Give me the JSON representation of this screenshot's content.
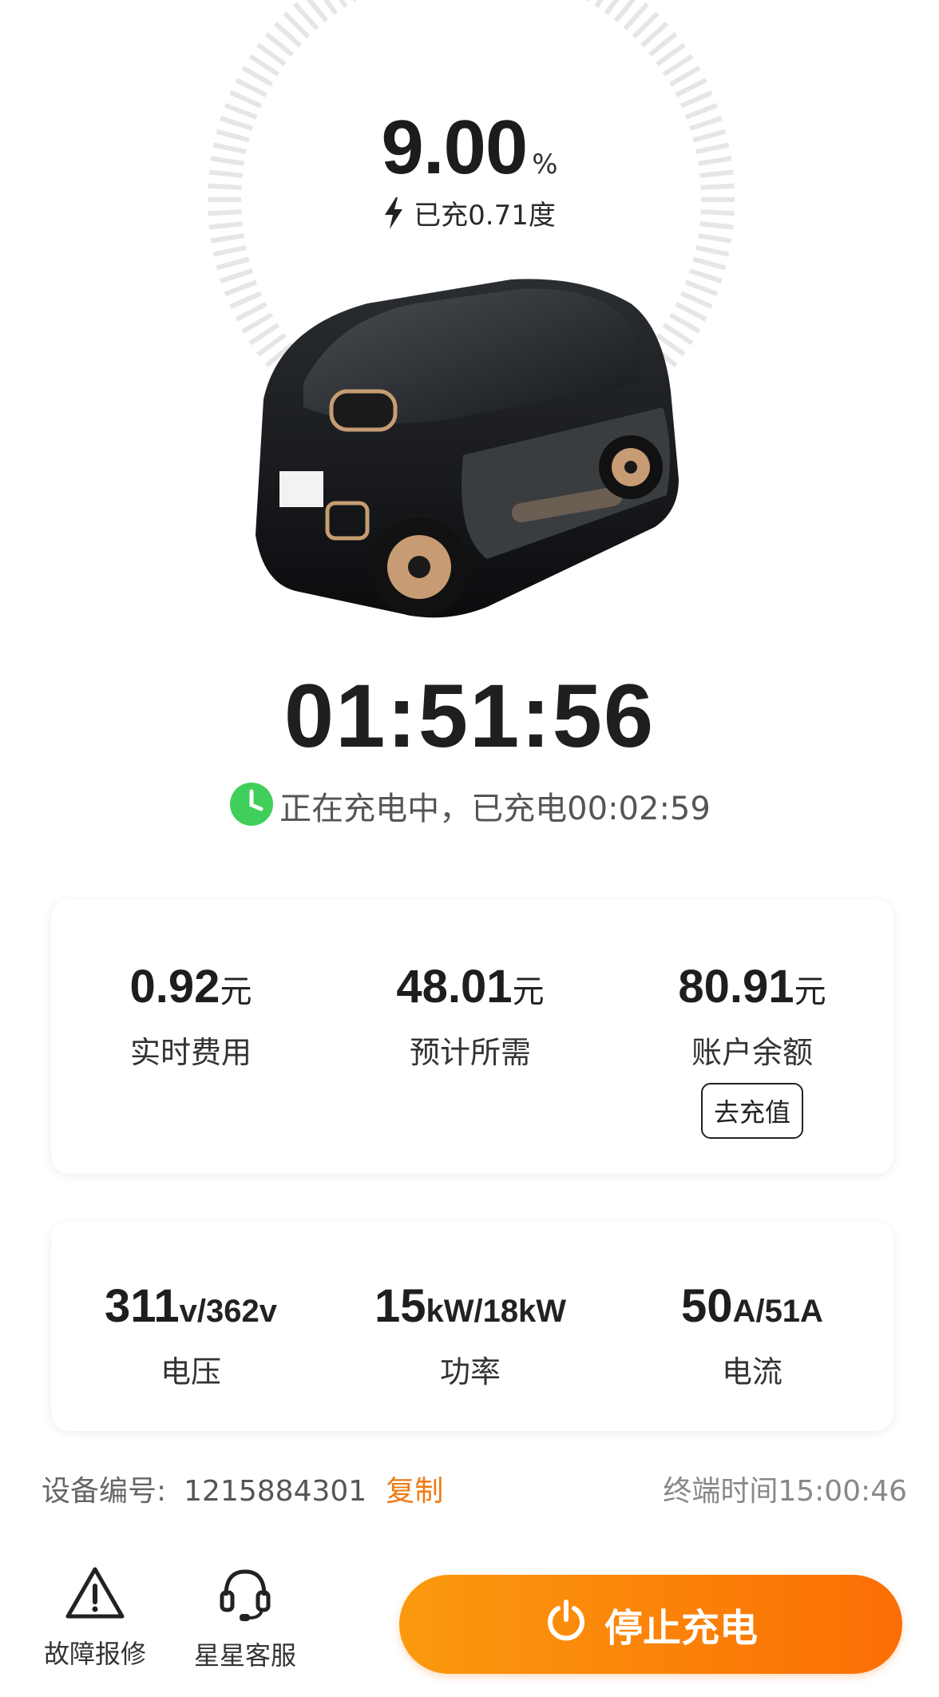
{
  "charge": {
    "percent": "9.00",
    "percent_unit": "%",
    "charged_energy": "已充0.71度",
    "remaining_time": "01:51:56",
    "status_text": "正在充电中，已充电00:02:59"
  },
  "cost_card": {
    "items": [
      {
        "value": "0.92",
        "unit": "元",
        "label": "实时费用"
      },
      {
        "value": "48.01",
        "unit": "元",
        "label": "预计所需"
      },
      {
        "value": "80.91",
        "unit": "元",
        "label": "账户余额"
      }
    ],
    "recharge_label": "去充值"
  },
  "power_card": {
    "items": [
      {
        "value": "311",
        "unit": "v/362v",
        "label": "电压"
      },
      {
        "value": "15",
        "unit": "kW/18kW",
        "label": "功率"
      },
      {
        "value": "50",
        "unit": "A/51A",
        "label": "电流"
      }
    ]
  },
  "device": {
    "label": "设备编号:",
    "number": "1215884301",
    "copy_label": "复制",
    "terminal_time": "终端时间15:00:46"
  },
  "bottom_bar": {
    "fault_label": "故障报修",
    "service_label": "星星客服",
    "stop_label": "停止充电"
  },
  "colors": {
    "accent_orange": "#fb7c08",
    "link_orange": "#f07a12",
    "clock_green": "#3fcf5a"
  },
  "icons": [
    "lightning-icon",
    "clock-icon",
    "warning-icon",
    "headset-icon",
    "power-icon"
  ]
}
